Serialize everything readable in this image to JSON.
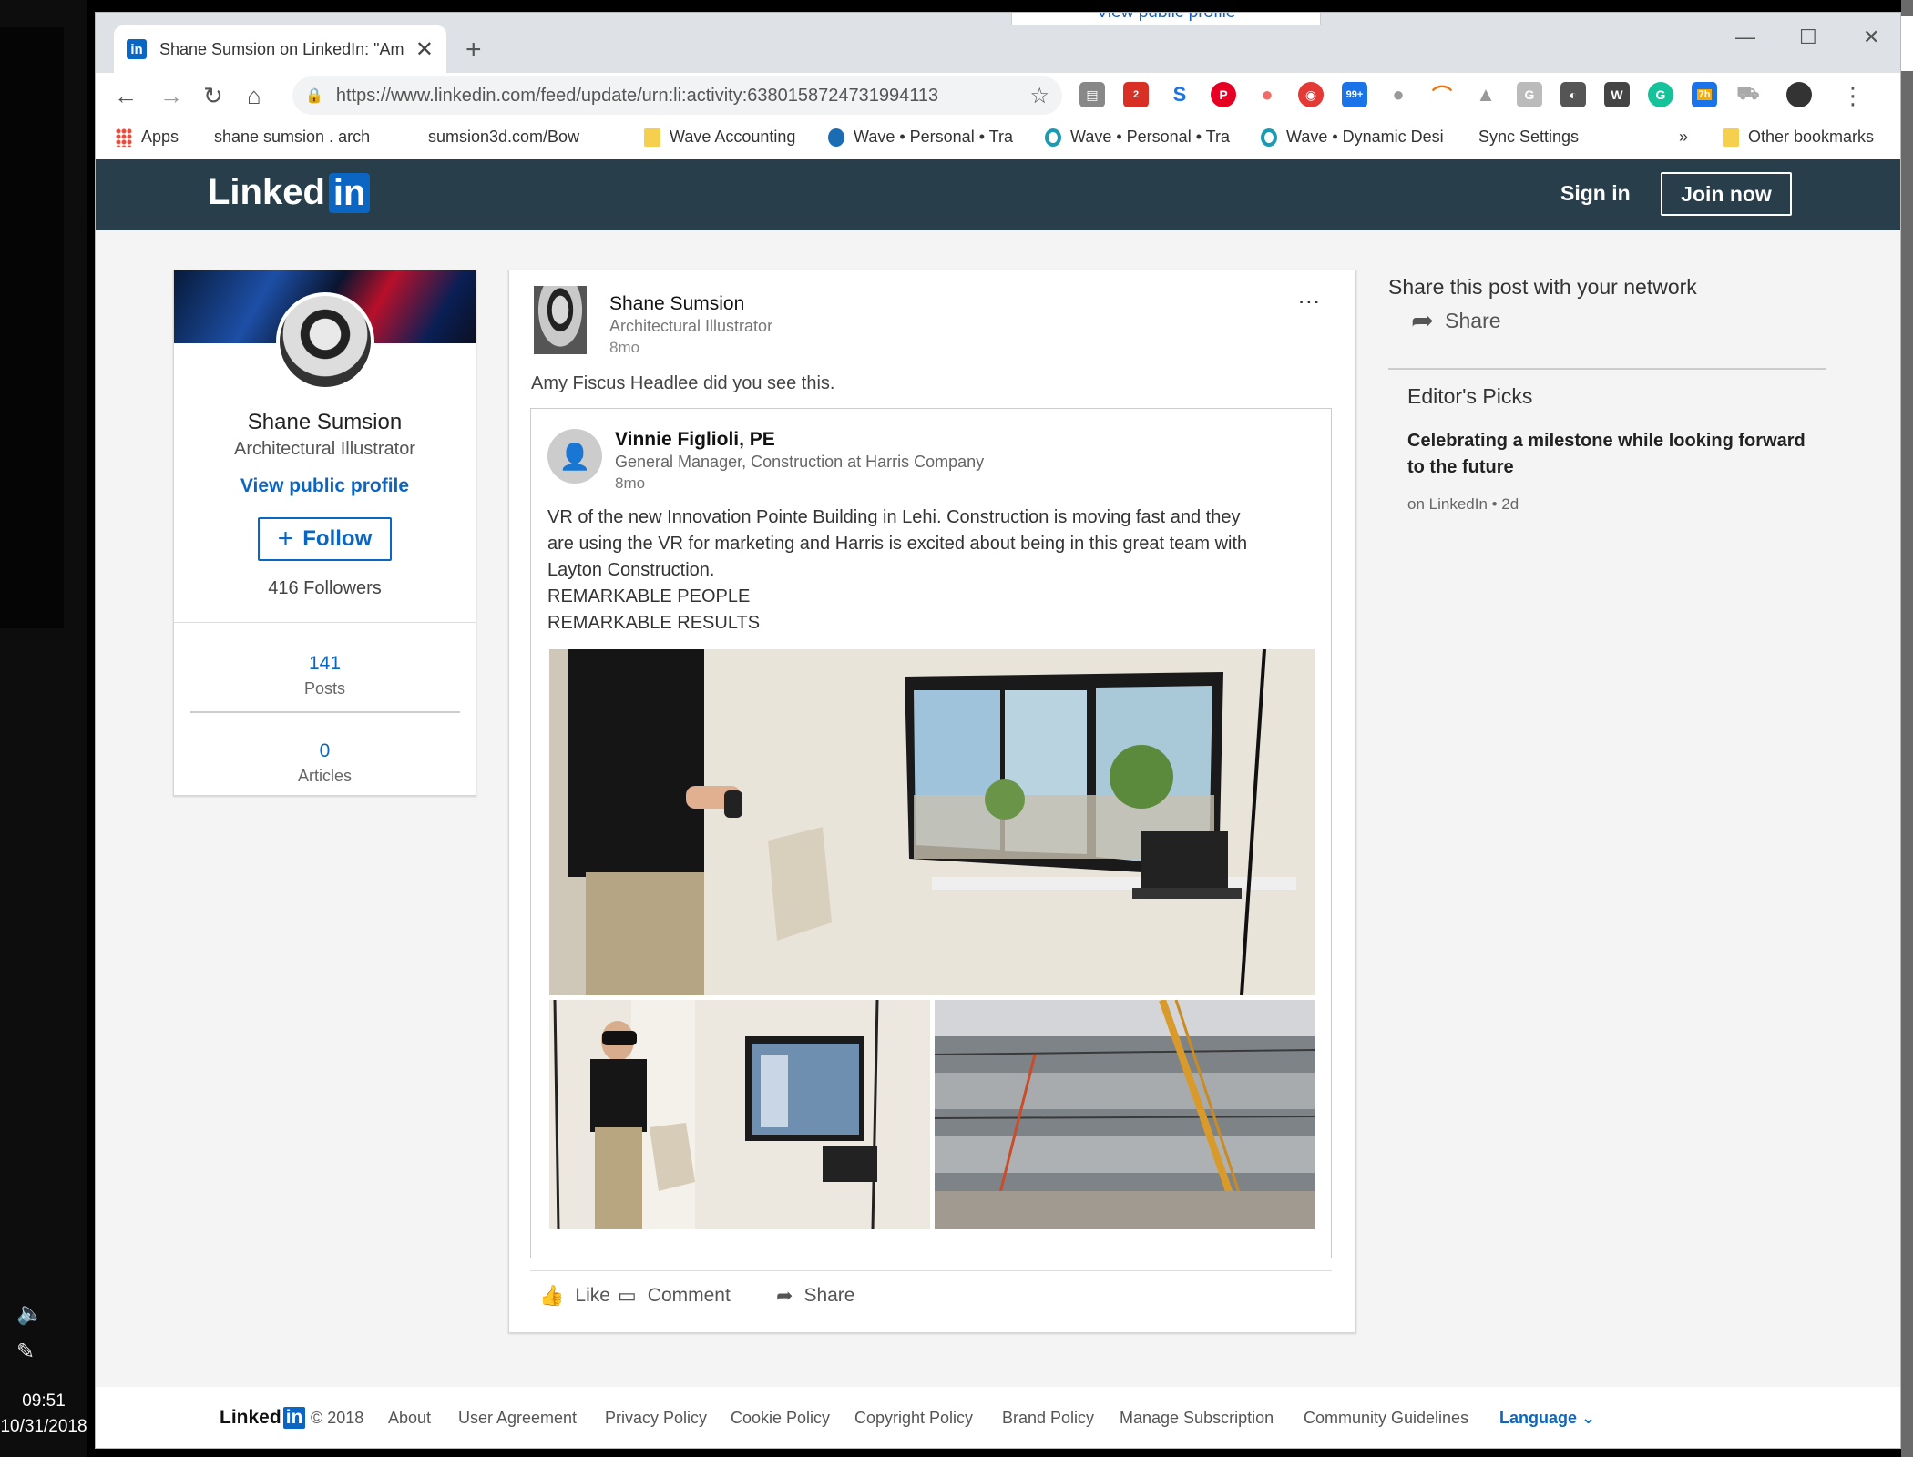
{
  "taskbar": {
    "time": "09:51",
    "date": "10/31/2018",
    "volume_icon": "speaker-icon",
    "pen_icon": "pen-icon"
  },
  "browser": {
    "behind_tab_text": "View public profile",
    "tab_title": "Shane Sumsion on LinkedIn: \"Am",
    "url": "https://www.linkedin.com/feed/update/urn:li:activity:6380158724731994113",
    "ext_badge_1": "2",
    "ext_badge_2": "99+",
    "ext_badge_3": "7h",
    "ext_g": "G",
    "ext_w": "W",
    "bookmarks": [
      {
        "label": "Apps",
        "icon": "apps"
      },
      {
        "label": "shane sumsion . arch",
        "icon": "page"
      },
      {
        "label": "sumsion3d.com/Bow",
        "icon": "page"
      },
      {
        "label": "Wave Accounting",
        "icon": "folder"
      },
      {
        "label": "Wave • Personal • Tra",
        "icon": "wave"
      },
      {
        "label": "Wave • Personal • Tra",
        "icon": "wavecirc"
      },
      {
        "label": "Wave • Dynamic Desi",
        "icon": "wavecirc"
      },
      {
        "label": "Sync Settings",
        "icon": "page"
      }
    ],
    "bookmarks_overflow": "»",
    "other_bookmarks": "Other bookmarks"
  },
  "header": {
    "logo_text": "Linked",
    "logo_in": "in",
    "sign_in": "Sign in",
    "join_now": "Join now"
  },
  "profile": {
    "name": "Shane Sumsion",
    "headline": "Architectural Illustrator",
    "view_profile": "View public profile",
    "follow": "Follow",
    "followers": "416 Followers",
    "posts_count": "141",
    "posts_label": "Posts",
    "articles_count": "0",
    "articles_label": "Articles"
  },
  "post": {
    "author": "Shane Sumsion",
    "headline": "Architectural Illustrator",
    "time": "8mo",
    "more": "...",
    "commentary": "Amy Fiscus Headlee did you see this.",
    "shared": {
      "author": "Vinnie Figlioli, PE",
      "headline": "General Manager, Construction at Harris Company",
      "time": "8mo",
      "body_lines": [
        "VR of the new Innovation Pointe Building in Lehi. Construction is moving fast and they",
        "are using the VR for marketing and Harris is excited about being in this great team with",
        "Layton Construction.",
        "REMARKABLE PEOPLE",
        "REMARKABLE RESULTS"
      ]
    },
    "actions": {
      "like": "Like",
      "comment": "Comment",
      "share": "Share"
    }
  },
  "rail": {
    "share_title": "Share this post with your network",
    "share_label": "Share",
    "editors_picks": "Editor's Picks",
    "pick_title": "Celebrating a milestone while looking forward to the future",
    "pick_meta": "on LinkedIn • 2d"
  },
  "footer": {
    "logo_text": "Linked",
    "logo_in": "in",
    "copyright": "© 2018",
    "links": [
      "About",
      "User Agreement",
      "Privacy Policy",
      "Cookie Policy",
      "Copyright Policy",
      "Brand Policy",
      "Manage Subscription",
      "Community Guidelines"
    ],
    "language": "Language"
  },
  "colors": {
    "linkedin_blue": "#0a66c2",
    "header_bg": "#283e4a"
  }
}
